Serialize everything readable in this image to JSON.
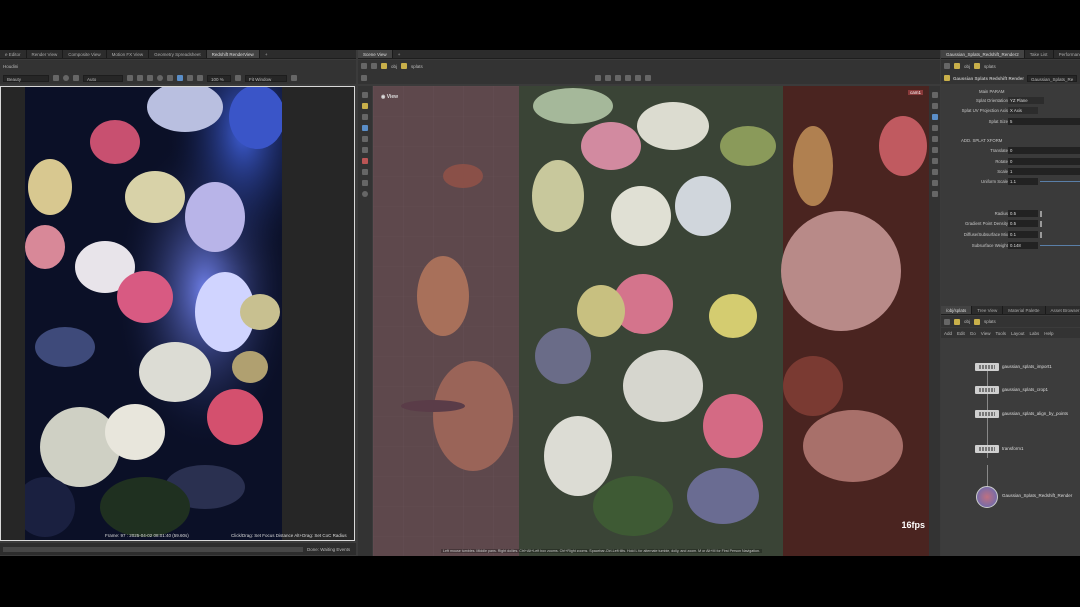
{
  "left_panel": {
    "tabs": [
      "e Editor",
      "Render View",
      "Composite View",
      "Motion FX View",
      "Geometry Spreadsheet",
      "Redshift RenderView"
    ],
    "path": "Houdini",
    "mode_dropdown": "Beauty",
    "auto_dropdown": "Auto",
    "zoom": "100 %",
    "fit_dropdown": "Fit Window",
    "frame_info": "Frame: 97 : 2025-04-02 08:01:40 (59.60s)",
    "hint": "Click/Drag: Set Focus Distance   Alt+Drag: Set CoC Radius",
    "status": "Done: Waiting Events"
  },
  "scene_panel": {
    "tabs": [
      "Scene View"
    ],
    "path_obj": "obj",
    "path_node": "splats",
    "view_label": "View",
    "cam_label": "cam1",
    "fps": "16fps",
    "hint": "Left mouse tumbles. Middle pans. Right dollies. Ctrl+Alt+Left box zooms. Ctrl+Right zooms. Spacebar-Ctrl-Left tilts. Hold L for alternate tumble, dolly, and zoom.   M or Alt+M for First Person Navigation."
  },
  "params_panel": {
    "tabs": [
      "Gaussian_Splats_Redshift_Render2",
      "Take List",
      "Performance Mo"
    ],
    "path_obj": "obj",
    "path_node": "splats",
    "node_type": "Gaussian Splats Redshift Render",
    "node_name": "Gaussian_Splats_Re",
    "section_main": "Main PARAM",
    "section_transform": "ADD. SPLAT XFORM",
    "rows": [
      {
        "label": "Splat Orientation",
        "value": "YZ Plane"
      },
      {
        "label": "Splat UV Projection Axis",
        "value": "X Axis"
      },
      {
        "label": "Splat Size",
        "value": "5"
      },
      {
        "label": "Translate",
        "value": "0"
      },
      {
        "label": "Rotate",
        "value": "0"
      },
      {
        "label": "Scale",
        "value": "1"
      },
      {
        "label": "Uniform Scale",
        "value": "1.1"
      },
      {
        "label": "Radius",
        "value": "0.5"
      },
      {
        "label": "Gradient Point Density",
        "value": "0.5"
      },
      {
        "label": "Diffuse/Subsurface Mix",
        "value": "0.1"
      },
      {
        "label": "Subsurface Weight",
        "value": "0.148"
      }
    ]
  },
  "network_panel": {
    "tabs": [
      "/obj/splats",
      "Tree View",
      "Material Palette",
      "Asset Browser"
    ],
    "path_obj": "obj",
    "path_node": "splats",
    "menu": [
      "Add",
      "Edit",
      "Go",
      "View",
      "Tools",
      "Layout",
      "Labs",
      "Help"
    ],
    "nodes": [
      "gaussian_splats_import1",
      "gaussian_splats_crop1",
      "gaussian_splats_align_by_points",
      "transform1",
      "Gaussian_Splats_Redshift_Render"
    ]
  }
}
